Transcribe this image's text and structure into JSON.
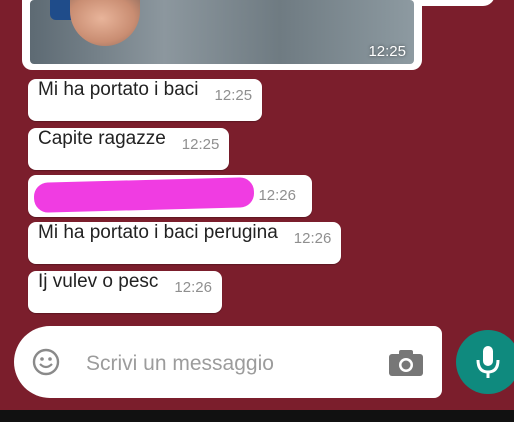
{
  "image_message": {
    "time": "12:25"
  },
  "messages": [
    {
      "text": "Mi ha portato i baci",
      "time": "12:25"
    },
    {
      "text": "Capite ragazze",
      "time": "12:25"
    },
    {
      "text": "",
      "time": "12:26",
      "redacted": true
    },
    {
      "text": "Mi ha portato i baci perugina",
      "time": "12:26"
    },
    {
      "text": "Ij vulev o pesc",
      "time": "12:26"
    }
  ],
  "input": {
    "placeholder": "Scrivi un messaggio"
  },
  "icons": {
    "emoji": "emoji-icon",
    "camera": "camera-icon",
    "mic": "mic-icon"
  },
  "colors": {
    "background": "#7b1e2c",
    "bubble": "#ffffff",
    "redaction": "#f03ce2",
    "send_button": "#0f8a7e"
  }
}
